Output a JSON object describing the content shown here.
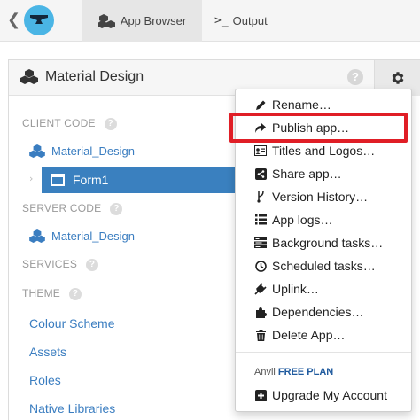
{
  "topbar": {
    "back_glyph": "❮",
    "tabs": [
      {
        "label": "App Browser",
        "icon": "cubes-icon",
        "active": true
      },
      {
        "label": "Output",
        "icon": "terminal-icon",
        "icon_text": ">_",
        "active": false
      }
    ]
  },
  "panel": {
    "title": "Material Design",
    "help": "?"
  },
  "sidebar": {
    "client_code": {
      "label": "CLIENT CODE",
      "help": "?",
      "module": "Material_Design",
      "form": "Form1",
      "chevron": "›"
    },
    "server_code": {
      "label": "SERVER CODE",
      "help": "?",
      "module": "Material_Design"
    },
    "services": {
      "label": "SERVICES",
      "help": "?"
    },
    "theme": {
      "label": "THEME",
      "help": "?"
    },
    "links": [
      "Colour Scheme",
      "Assets",
      "Roles",
      "Native Libraries"
    ]
  },
  "menu": {
    "items": [
      {
        "label": "Rename…",
        "icon": "pencil-icon"
      },
      {
        "label": "Publish app…",
        "icon": "share-arrow-icon"
      },
      {
        "label": "Titles and Logos…",
        "icon": "id-card-icon"
      },
      {
        "label": "Share app…",
        "icon": "share-nodes-icon"
      },
      {
        "label": "Version History…",
        "icon": "branch-icon"
      },
      {
        "label": "App logs…",
        "icon": "list-icon"
      },
      {
        "label": "Background tasks…",
        "icon": "tasks-icon"
      },
      {
        "label": "Scheduled tasks…",
        "icon": "clock-icon"
      },
      {
        "label": "Uplink…",
        "icon": "plug-icon"
      },
      {
        "label": "Dependencies…",
        "icon": "puzzle-icon"
      },
      {
        "label": "Delete App…",
        "icon": "trash-icon"
      }
    ],
    "plan_prefix": "Anvil",
    "plan_name": "FREE PLAN",
    "upgrade": "Upgrade My Account"
  },
  "colors": {
    "accent": "#3a80bf",
    "link": "#3a7dc0",
    "highlight": "#e01e26",
    "logo": "#4ab5e5"
  }
}
